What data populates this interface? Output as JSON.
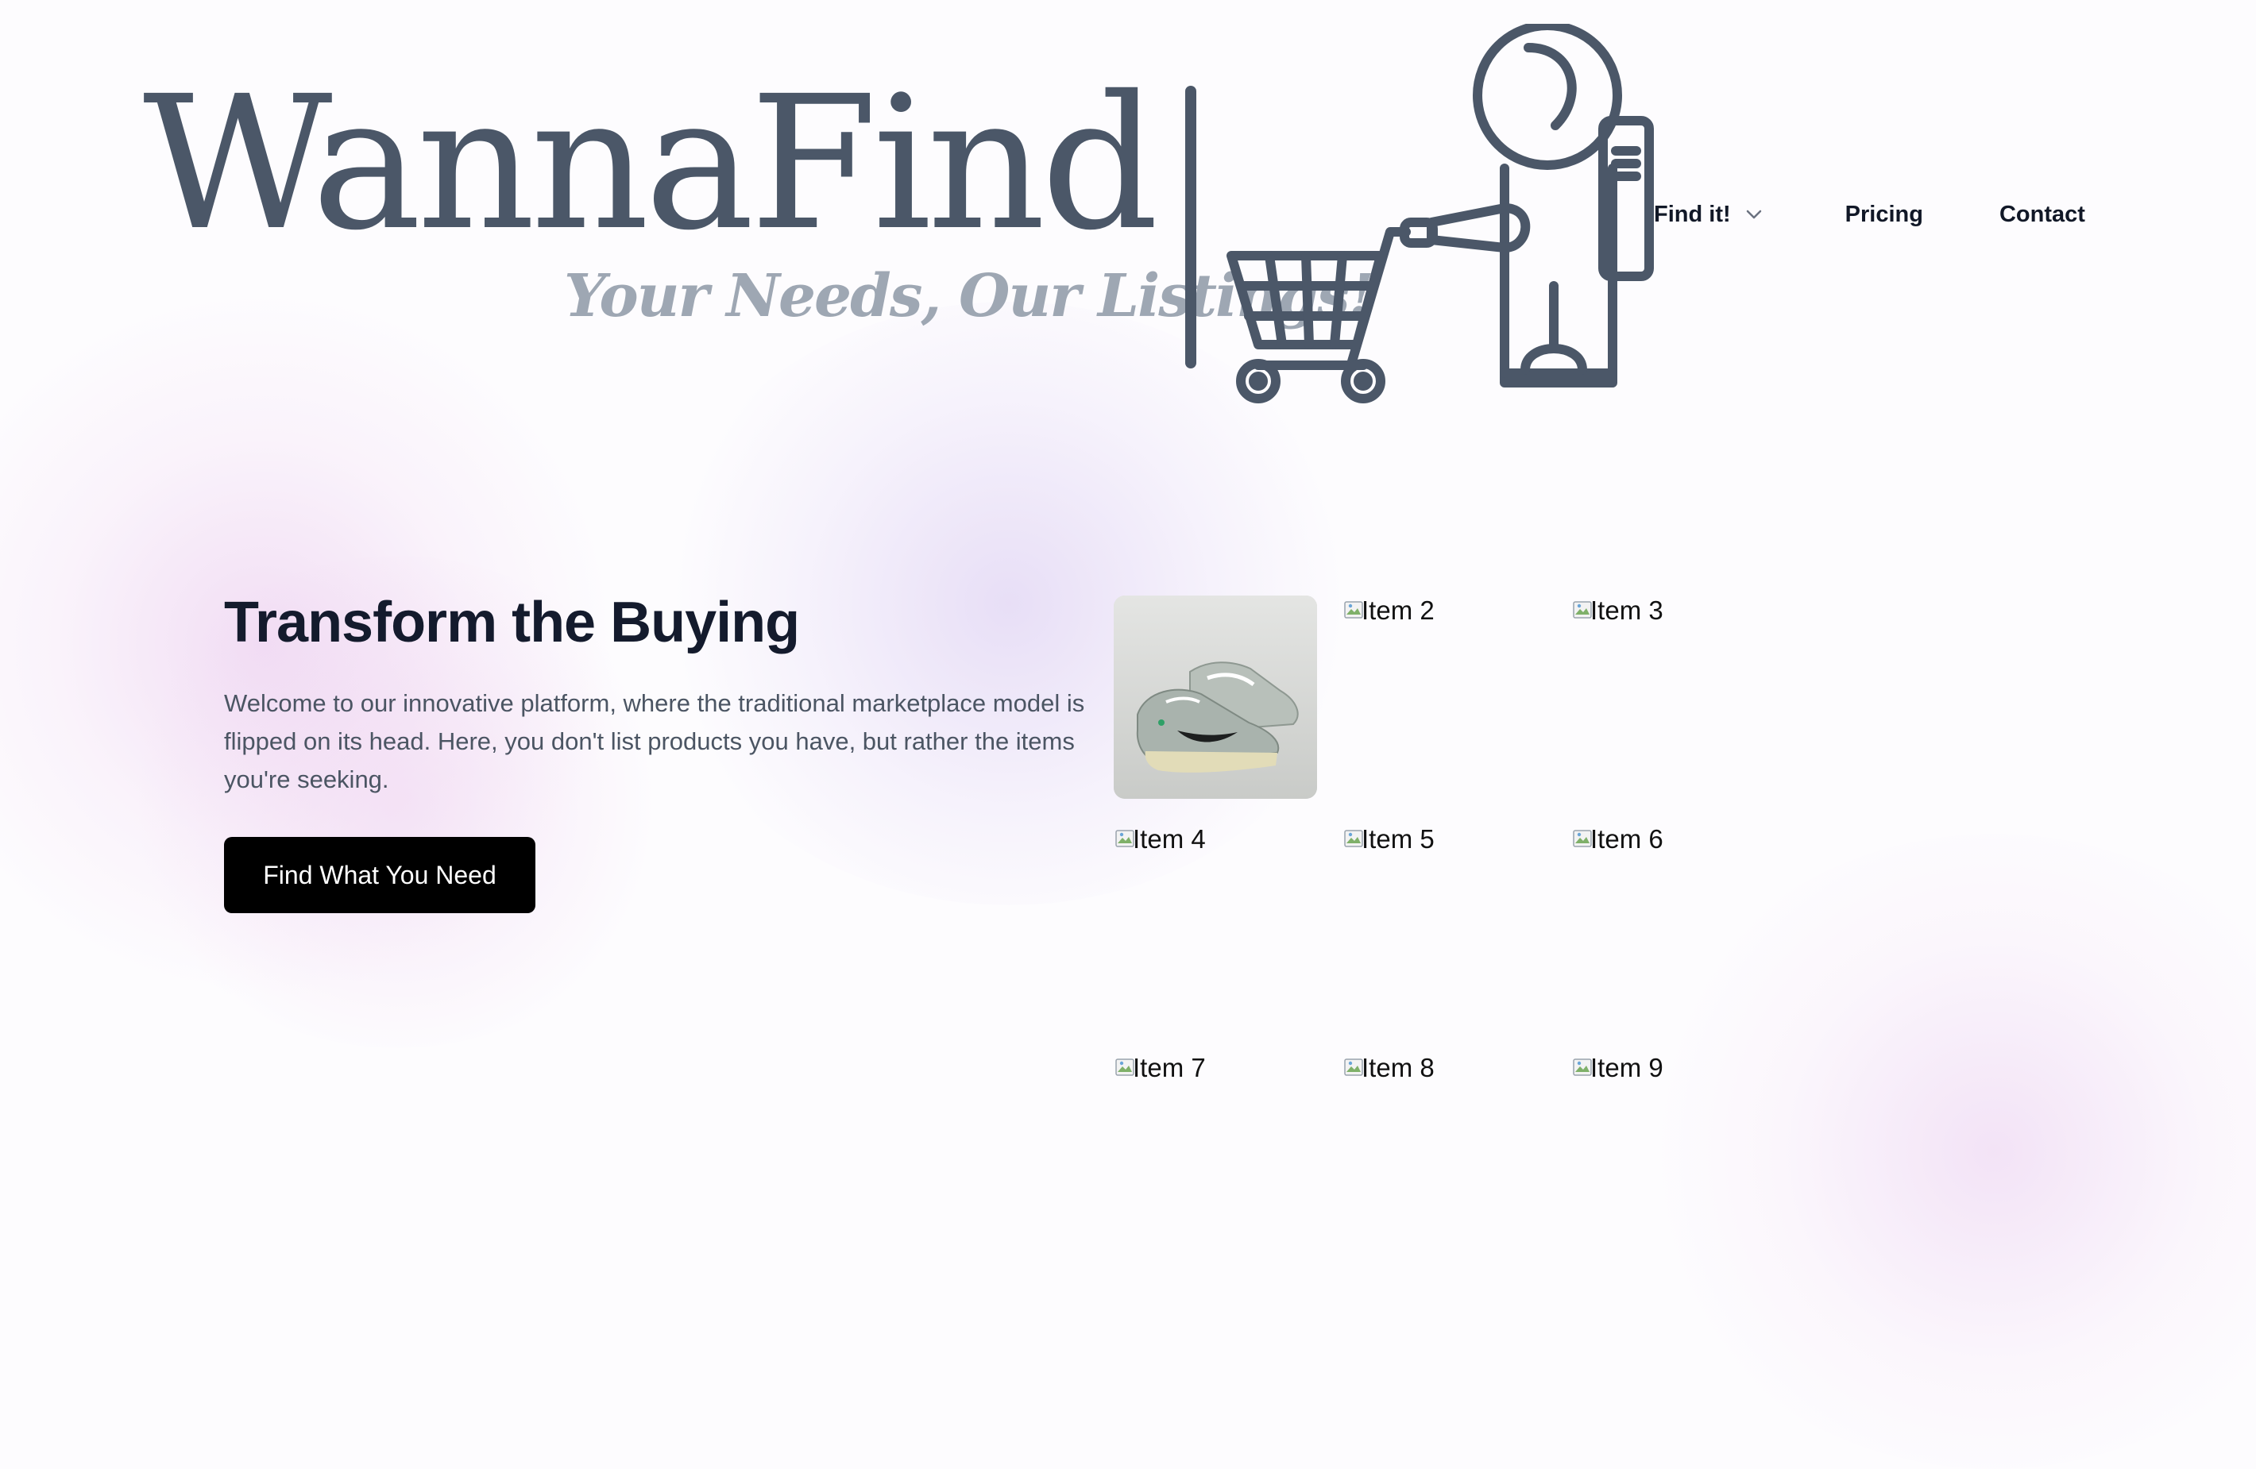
{
  "brand": {
    "wordmark": "WannaFind",
    "tagline": "Your Needs, Our Listings!"
  },
  "nav": {
    "items": [
      {
        "label": "Find it!",
        "has_dropdown": true
      },
      {
        "label": "Pricing"
      },
      {
        "label": "Contact"
      }
    ]
  },
  "hero": {
    "title": "Transform the Buying",
    "description": "Welcome to our innovative platform, where the traditional marketplace model is flipped on its head. Here, you don't list products you have, but rather the items you're seeking.",
    "cta_label": "Find What You Need"
  },
  "grid": {
    "items": [
      {
        "alt": "Item 1",
        "image": "sneakers-photo"
      },
      {
        "alt": "Item 2"
      },
      {
        "alt": "Item 3"
      },
      {
        "alt": "Item 4"
      },
      {
        "alt": "Item 5"
      },
      {
        "alt": "Item 6"
      },
      {
        "alt": "Item 7"
      },
      {
        "alt": "Item 8"
      },
      {
        "alt": "Item 9"
      }
    ]
  },
  "colors": {
    "logo": "#4b5768",
    "tagline": "#9ea7b3",
    "cta_bg": "#000000",
    "heading": "#141b2d",
    "body_text": "#4b5563"
  }
}
